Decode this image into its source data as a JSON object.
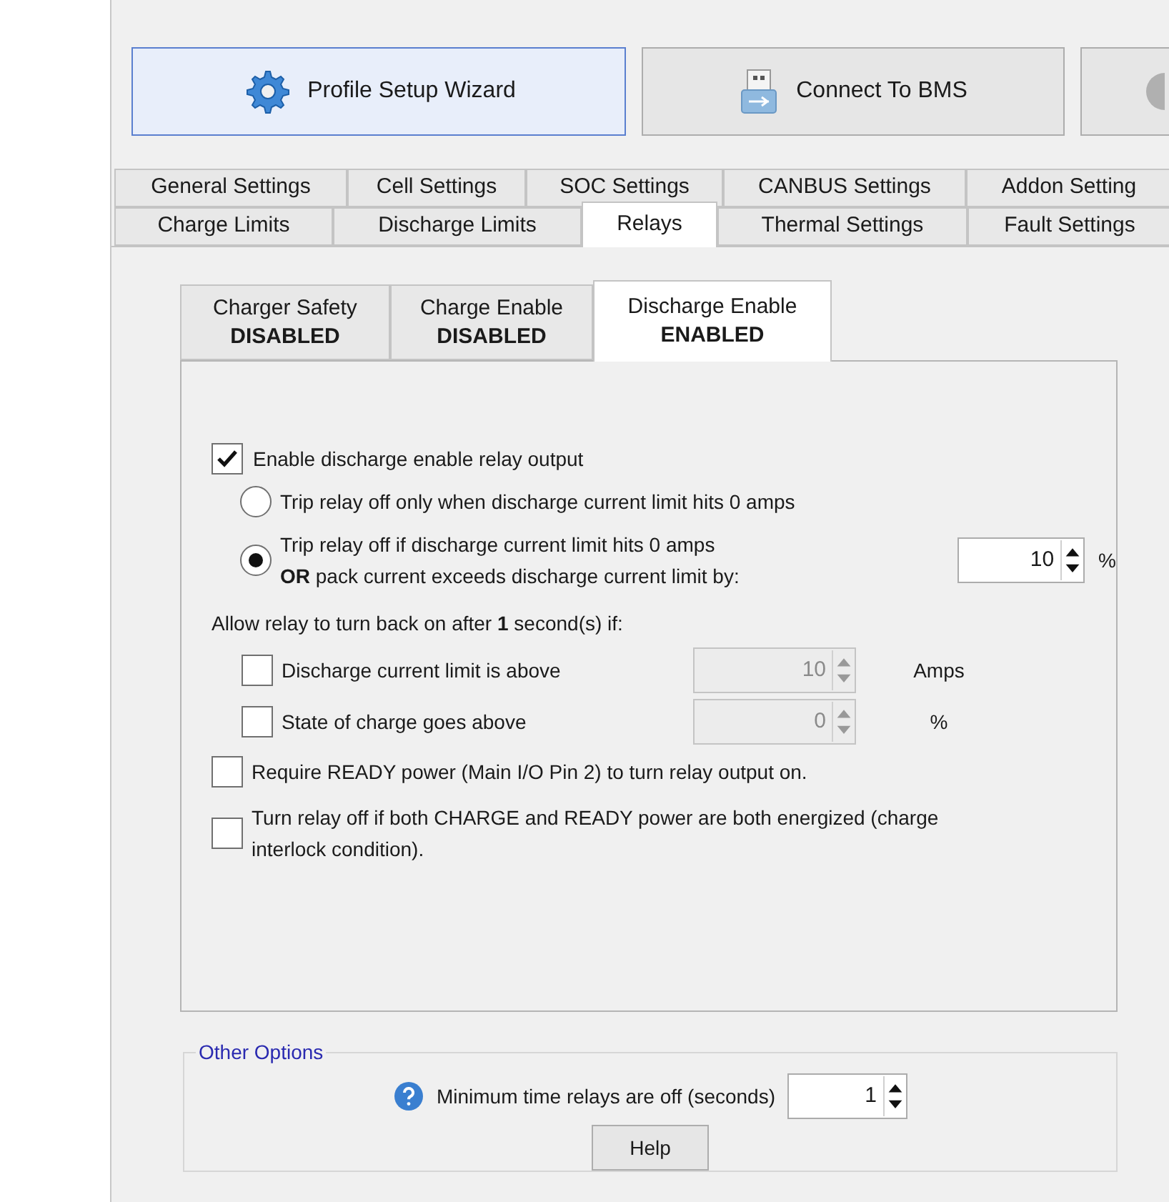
{
  "toolbar": {
    "buttons": [
      {
        "kind": "wizard",
        "label": "Profile Setup Wizard",
        "selected": true
      },
      {
        "kind": "usb",
        "label": "Connect To BMS",
        "selected": false
      },
      {
        "kind": "other",
        "selected": false
      }
    ]
  },
  "tab_rows": [
    [
      {
        "label": "General Settings",
        "selected": false
      },
      {
        "label": "Cell Settings",
        "selected": false
      },
      {
        "label": "SOC Settings",
        "selected": false
      },
      {
        "label": "CANBUS Settings",
        "selected": false
      },
      {
        "label": "Addon Setting",
        "selected": false
      }
    ],
    [
      {
        "label": "Charge Limits",
        "selected": false
      },
      {
        "label": "Discharge Limits",
        "selected": false
      },
      {
        "label": "Relays",
        "selected": true
      },
      {
        "label": "Thermal Settings",
        "selected": false
      },
      {
        "label": "Fault Settings",
        "selected": false
      }
    ]
  ],
  "relay_tabs": [
    {
      "title": "Charger Safety",
      "status": "DISABLED",
      "selected": false
    },
    {
      "title": "Charge Enable",
      "status": "DISABLED",
      "selected": false
    },
    {
      "title": "Discharge Enable",
      "status": "ENABLED",
      "selected": true
    }
  ],
  "enable_output": {
    "label": "Enable discharge enable relay output",
    "checked": true
  },
  "trip_modes": [
    {
      "lines": [
        "Trip relay off only when discharge current limit hits 0 amps"
      ],
      "selected": false
    },
    {
      "lines": [
        "Trip relay off if discharge current limit hits 0 amps",
        "**OR** pack current exceeds discharge current limit by:"
      ],
      "selected": true,
      "value": "10",
      "unit": "%"
    }
  ],
  "turn_back_on": {
    "label": "Allow relay to turn back on after **1** second(s) if:",
    "conditions": [
      {
        "label": "Discharge current limit is above",
        "checked": false,
        "value": "10",
        "unit": "Amps",
        "disabled": true
      },
      {
        "label": "State of charge goes above",
        "checked": false,
        "value": "0",
        "unit": "%",
        "disabled": true
      }
    ]
  },
  "extra_options": [
    {
      "label": "Require READY power (Main I/O Pin 2) to turn relay output on.",
      "checked": false
    },
    {
      "label": "Turn relay off if both CHARGE and READY power are both energized (charge interlock condition).",
      "checked": false
    }
  ],
  "other_options": {
    "title": "Other Options",
    "label": "Minimum time relays are off (seconds)",
    "value": "1",
    "button": "Help"
  }
}
